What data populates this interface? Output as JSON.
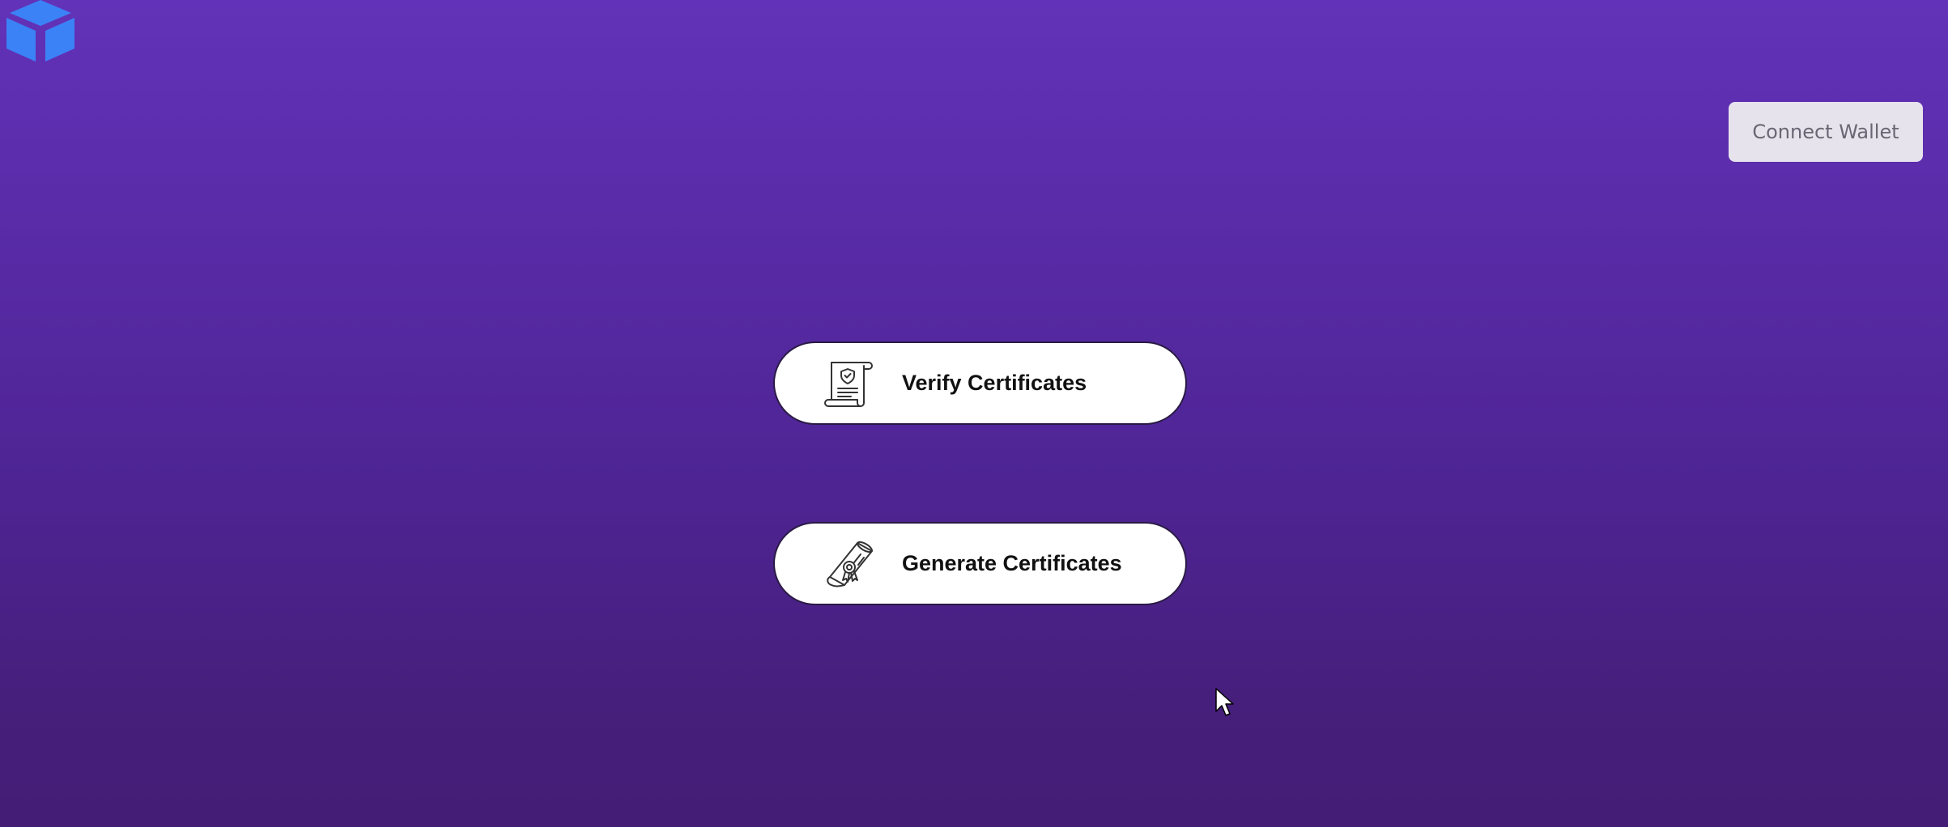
{
  "header": {
    "logo_icon": "cube-logo-icon",
    "logo_color": "#3b82f6",
    "connect_wallet_label": "Connect Wallet"
  },
  "main": {
    "actions": [
      {
        "label": "Verify Certificates",
        "icon": "certificate-scroll-icon"
      },
      {
        "label": "Generate Certificates",
        "icon": "diploma-icon"
      }
    ]
  },
  "colors": {
    "background_top": "#6232b8",
    "background_bottom": "#431d75",
    "button_background": "#ffffff",
    "wallet_button_background": "#e6e3ec"
  }
}
